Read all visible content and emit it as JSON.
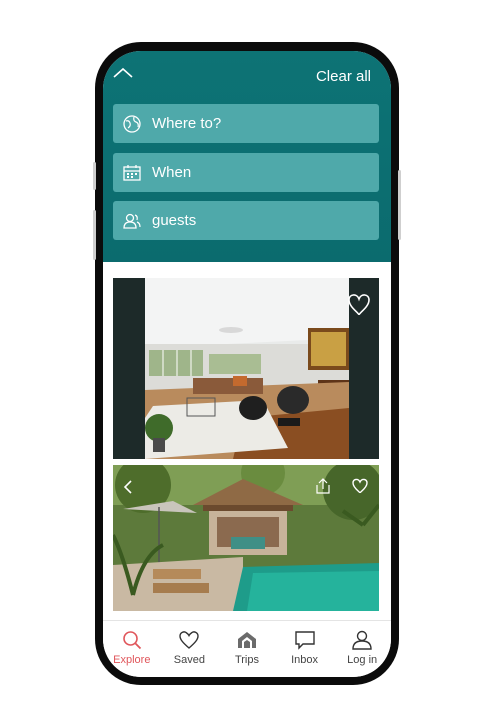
{
  "header": {
    "clear_all_label": "Clear all"
  },
  "search_fields": {
    "where": "Where to?",
    "when": "When",
    "guests": "guests"
  },
  "tabbar": {
    "items": [
      {
        "label": "Explore",
        "icon": "search-icon",
        "active": true
      },
      {
        "label": "Saved",
        "icon": "heart-icon",
        "active": false
      },
      {
        "label": "Trips",
        "icon": "trips-icon",
        "active": false
      },
      {
        "label": "Inbox",
        "icon": "chat-bubble-icon",
        "active": false
      },
      {
        "label": "Log in",
        "icon": "user-icon",
        "active": false
      }
    ]
  },
  "colors": {
    "header_teal": "#0d7375",
    "field_teal": "#4fa9aa",
    "active_tab": "#e0565b"
  }
}
